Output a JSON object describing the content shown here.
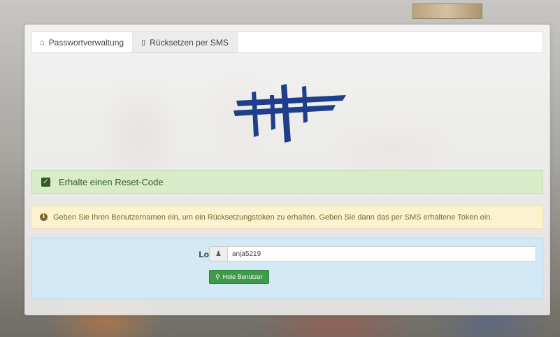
{
  "tabs": [
    {
      "label": "Passwortverwaltung",
      "icon": "home-icon",
      "active": true
    },
    {
      "label": "Rücksetzen per SMS",
      "icon": "mobile-icon",
      "active": false
    }
  ],
  "success_alert": {
    "text": "Erhalte einen Reset-Code",
    "icon": "check-square-icon"
  },
  "warning_alert": {
    "text": "Geben Sie Ihren Benutzernamen ein, um ein Rücksetzungstoken zu erhalten. Geben Sie dann das per SMS erhaltene Token ein.",
    "icon": "info-circle-icon"
  },
  "login_form": {
    "label": "Login",
    "input_icon": "user-icon",
    "value": "anja5219",
    "button_label": "Hole Benutzer",
    "button_icon": "search-icon"
  },
  "colors": {
    "success_bg": "#d8ecc9",
    "warning_bg": "#fbf3d0",
    "info_bg": "#d3e9f6",
    "button_green": "#3f9a4a",
    "logo_blue": "#1f3f8a"
  }
}
